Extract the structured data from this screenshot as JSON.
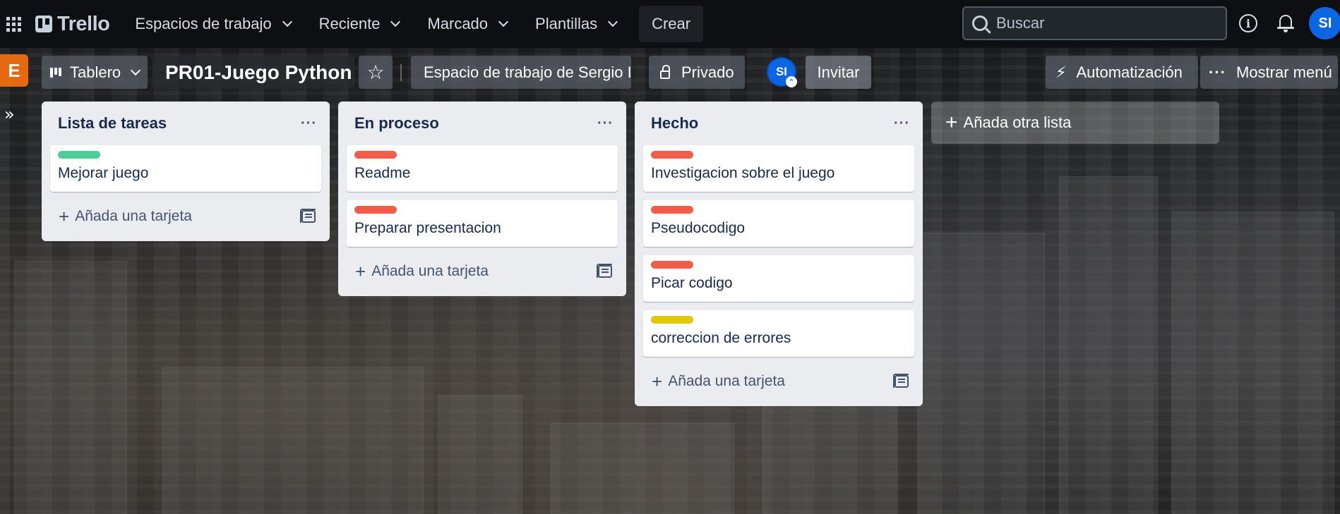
{
  "header": {
    "logo": "Trello",
    "nav": [
      {
        "label": "Espacios de trabajo"
      },
      {
        "label": "Reciente"
      },
      {
        "label": "Marcado"
      },
      {
        "label": "Plantillas"
      }
    ],
    "create_label": "Crear",
    "search_placeholder": "Buscar",
    "avatar_initials": "SI",
    "icons": [
      "apps-grid-icon",
      "info-icon",
      "bell-icon"
    ]
  },
  "board": {
    "workspace_badge": "E",
    "view_label": "Tablero",
    "title": "PR01-Juego Python",
    "workspace_label": "Espacio de trabajo de Sergio I",
    "visibility_label": "Privado",
    "member_initials": "SI",
    "invite_label": "Invitar",
    "automation_label": "Automatización",
    "menu_label": "Mostrar menú"
  },
  "lists": [
    {
      "title": "Lista de tareas",
      "cards": [
        {
          "title": "Mejorar juego",
          "label_color": "#4bce97"
        }
      ],
      "add_card_label": "Añada una tarjeta"
    },
    {
      "title": "En proceso",
      "cards": [
        {
          "title": "Readme",
          "label_color": "#f15c4b"
        },
        {
          "title": "Preparar presentacion",
          "label_color": "#f15c4b"
        }
      ],
      "add_card_label": "Añada una tarjeta"
    },
    {
      "title": "Hecho",
      "cards": [
        {
          "title": "Investigacion sobre el juego",
          "label_color": "#f15c4b"
        },
        {
          "title": "Pseudocodigo",
          "label_color": "#f15c4b"
        },
        {
          "title": "Picar codigo",
          "label_color": "#f15c4b"
        },
        {
          "title": "correccion de errores",
          "label_color": "#e2c800"
        }
      ],
      "add_card_label": "Añada una tarjeta"
    }
  ],
  "add_list_label": "Añada otra lista",
  "colors": {
    "accent": "#0c66e4",
    "workspace_badge": "#e56910",
    "list_bg": "#ebecf0"
  }
}
